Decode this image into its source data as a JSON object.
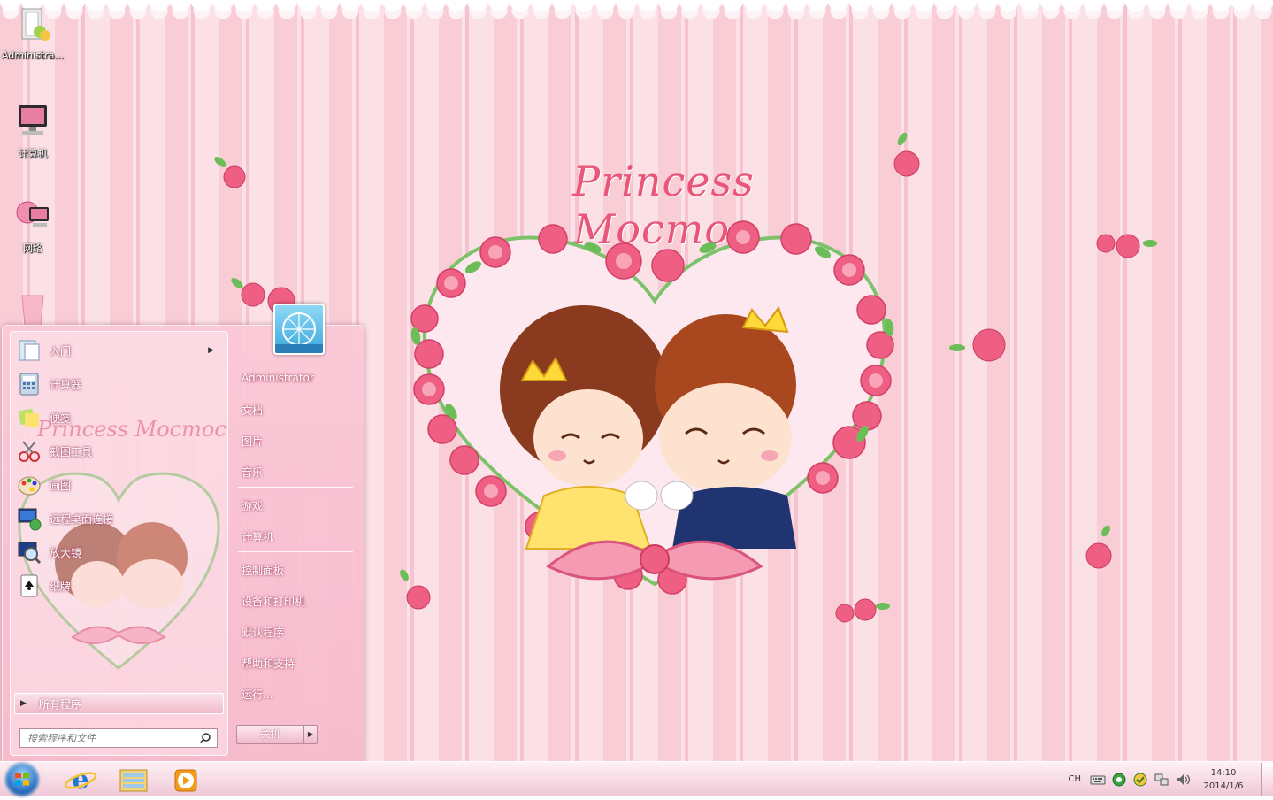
{
  "wallpaper": {
    "title": "Princess Mocmoc"
  },
  "desktop": {
    "icons": [
      {
        "label": "Administra...",
        "icon": "user-folder-icon"
      },
      {
        "label": "计算机",
        "icon": "computer-icon"
      },
      {
        "label": "网络",
        "icon": "network-icon"
      },
      {
        "label": "",
        "icon": "recycle-bin-icon"
      }
    ]
  },
  "start_menu": {
    "programs": [
      {
        "label": "入门",
        "icon": "getting-started-icon",
        "has_submenu": true
      },
      {
        "label": "计算器",
        "icon": "calculator-icon",
        "has_submenu": false
      },
      {
        "label": "便笺",
        "icon": "sticky-notes-icon",
        "has_submenu": false
      },
      {
        "label": "截图工具",
        "icon": "snipping-tool-icon",
        "has_submenu": false
      },
      {
        "label": "画图",
        "icon": "paint-icon",
        "has_submenu": false
      },
      {
        "label": "远程桌面连接",
        "icon": "remote-desktop-icon",
        "has_submenu": false
      },
      {
        "label": "放大镜",
        "icon": "magnifier-icon",
        "has_submenu": false
      },
      {
        "label": "纸牌",
        "icon": "solitaire-icon",
        "has_submenu": false
      }
    ],
    "ghost_title": "Princess Mocmoc",
    "all_programs": "所有程序",
    "search_placeholder": "搜索程序和文件",
    "user_name": "Administrator",
    "links_group1": [
      "文档",
      "图片",
      "音乐"
    ],
    "links_group2": [
      "游戏",
      "计算机"
    ],
    "links_group3": [
      "控制面板",
      "设备和打印机",
      "默认程序",
      "帮助和支持",
      "运行..."
    ],
    "shutdown_label": "关机"
  },
  "taskbar": {
    "pinned": [
      {
        "name": "internet-explorer",
        "icon": "ie-icon"
      },
      {
        "name": "file-explorer",
        "icon": "folder-icon"
      },
      {
        "name": "media-player",
        "icon": "media-player-icon"
      }
    ],
    "tray": {
      "language": "CH",
      "time": "14:10",
      "date": "2014/1/6"
    }
  },
  "colors": {
    "accent_pink": "#e8577a",
    "stripe_light": "#fbe2e8",
    "stripe_dark": "#f9cdd6"
  }
}
